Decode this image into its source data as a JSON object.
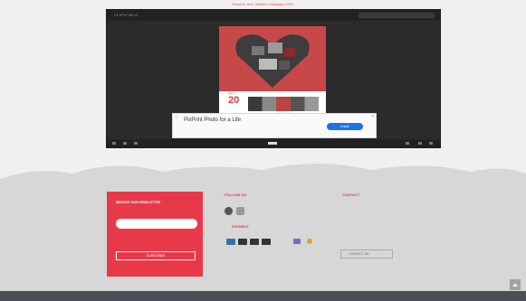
{
  "banner": {
    "text": "Read for free: Steelco Catalogue 2020"
  },
  "viewer": {
    "logo": "FLIPHTML5",
    "search_placeholder": "",
    "page": {
      "label": "Since",
      "number": "20"
    }
  },
  "ad": {
    "title": "PixPrint Photo for a Life",
    "subtitle": "",
    "button_label": "Install",
    "close_label": "×",
    "info_label": "ⓘ"
  },
  "newsletter": {
    "title": "RECEIVE OUR NEWSLETTER",
    "email_placeholder": "",
    "consent_label": "",
    "button_label": "SUBSCRIBE"
  },
  "follow": {
    "heading": "FOLLOW US"
  },
  "payment": {
    "heading": "PAYMENT"
  },
  "contact": {
    "heading": "CONTACT",
    "address_lines": [
      "",
      "",
      "",
      ""
    ],
    "phone": "",
    "email": "",
    "button_label": "CONTACT US"
  },
  "bottom_bar": {
    "left_text": "",
    "right_text": ""
  },
  "colors": {
    "brand_red": "#e8394a",
    "footer_bg": "#d7d7d7",
    "viewer_bg": "#2b2b2b"
  }
}
